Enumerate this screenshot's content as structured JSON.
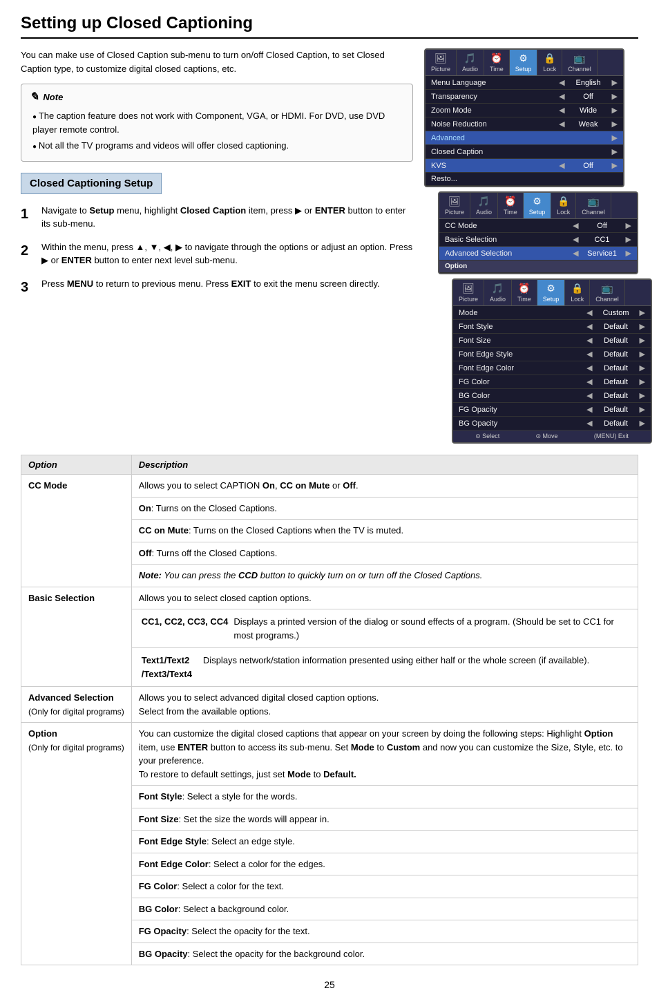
{
  "page": {
    "title": "Setting up Closed Captioning",
    "page_number": "25"
  },
  "intro": {
    "text": "You can make use of Closed Caption sub-menu to turn on/off Closed Caption, to set Closed Caption type, to customize digital closed captions, etc."
  },
  "note": {
    "header": "Note",
    "items": [
      "The caption feature does not work with Component, VGA, or HDMI. For DVD, use DVD player remote control.",
      "Not all the TV programs and videos will offer closed captioning."
    ]
  },
  "section": {
    "title": "Closed Captioning Setup"
  },
  "steps": [
    {
      "num": "1",
      "text": "Navigate to Setup menu, highlight Closed Caption item, press ▶ or ENTER button to enter its sub-menu."
    },
    {
      "num": "2",
      "text": "Within the menu, press ▲, ▼, ◀, ▶ to navigate through the options or adjust an option. Press ▶ or ENTER button to enter next level sub-menu."
    },
    {
      "num": "3",
      "text": "Press MENU to return to previous menu. Press EXIT to exit the menu screen directly."
    }
  ],
  "menus": [
    {
      "id": "menu1",
      "tabs": [
        {
          "label": "Picture",
          "icon": "🖼",
          "active": false
        },
        {
          "label": "Audio",
          "icon": "🎵",
          "active": false
        },
        {
          "label": "Time",
          "icon": "⏰",
          "active": false
        },
        {
          "label": "Setup",
          "icon": "⚙",
          "active": true
        },
        {
          "label": "Lock",
          "icon": "🔒",
          "active": false
        },
        {
          "label": "Channel",
          "icon": "📺",
          "active": false
        }
      ],
      "rows": [
        {
          "label": "Menu Language",
          "arrow_l": "◀",
          "value": "English",
          "arrow_r": "▶",
          "highlight": false,
          "section": false
        },
        {
          "label": "Transparency",
          "arrow_l": "◀",
          "value": "Off",
          "arrow_r": "▶",
          "highlight": false,
          "section": false
        },
        {
          "label": "Zoom Mode",
          "arrow_l": "◀",
          "value": "Wide",
          "arrow_r": "▶",
          "highlight": false,
          "section": false
        },
        {
          "label": "Noise Reduction",
          "arrow_l": "◀",
          "value": "Weak",
          "arrow_r": "▶",
          "highlight": false,
          "section": false
        },
        {
          "label": "Advanced",
          "arrow_l": "",
          "value": "",
          "arrow_r": "▶",
          "highlight": false,
          "section": true
        },
        {
          "label": "Closed Caption",
          "arrow_l": "",
          "value": "",
          "arrow_r": "▶",
          "highlight": false,
          "section": false
        },
        {
          "label": "KVS",
          "arrow_l": "◀",
          "value": "Off",
          "arrow_r": "▶",
          "highlight": true,
          "section": false
        },
        {
          "label": "Resto...",
          "arrow_l": "",
          "value": "",
          "arrow_r": "",
          "highlight": false,
          "section": false
        }
      ],
      "footer": []
    },
    {
      "id": "menu2",
      "tabs": [
        {
          "label": "Picture",
          "icon": "🖼",
          "active": false
        },
        {
          "label": "Audio",
          "icon": "🎵",
          "active": false
        },
        {
          "label": "Time",
          "icon": "⏰",
          "active": false
        },
        {
          "label": "Setup",
          "icon": "⚙",
          "active": true
        },
        {
          "label": "Lock",
          "icon": "🔒",
          "active": false
        },
        {
          "label": "Channel",
          "icon": "📺",
          "active": false
        }
      ],
      "rows": [
        {
          "label": "CC Mode",
          "arrow_l": "◀",
          "value": "Off",
          "arrow_r": "▶",
          "highlight": false,
          "section": false
        },
        {
          "label": "Basic Selection",
          "arrow_l": "◀",
          "value": "CC1",
          "arrow_r": "▶",
          "highlight": false,
          "section": false
        },
        {
          "label": "Advanced Selection",
          "arrow_l": "◀",
          "value": "Service1",
          "arrow_r": "▶",
          "highlight": true,
          "section": false
        },
        {
          "label": "Option",
          "arrow_l": "",
          "value": "",
          "arrow_r": "",
          "highlight": false,
          "section": true
        }
      ],
      "footer": []
    },
    {
      "id": "menu3",
      "tabs": [
        {
          "label": "Picture",
          "icon": "🖼",
          "active": false
        },
        {
          "label": "Audio",
          "icon": "🎵",
          "active": false
        },
        {
          "label": "Time",
          "icon": "⏰",
          "active": false
        },
        {
          "label": "Setup",
          "icon": "⚙",
          "active": true
        },
        {
          "label": "Lock",
          "icon": "🔒",
          "active": false
        },
        {
          "label": "Channel",
          "icon": "📺",
          "active": false
        }
      ],
      "rows": [
        {
          "label": "Mode",
          "arrow_l": "◀",
          "value": "Custom",
          "arrow_r": "▶",
          "highlight": false,
          "section": false
        },
        {
          "label": "Font Style",
          "arrow_l": "◀",
          "value": "Default",
          "arrow_r": "▶",
          "highlight": false,
          "section": false
        },
        {
          "label": "Font Size",
          "arrow_l": "◀",
          "value": "Default",
          "arrow_r": "▶",
          "highlight": false,
          "section": false
        },
        {
          "label": "Font Edge Style",
          "arrow_l": "◀",
          "value": "Default",
          "arrow_r": "▶",
          "highlight": false,
          "section": false
        },
        {
          "label": "Font Edge Color",
          "arrow_l": "◀",
          "value": "Default",
          "arrow_r": "▶",
          "highlight": false,
          "section": false
        },
        {
          "label": "FG Color",
          "arrow_l": "◀",
          "value": "Default",
          "arrow_r": "▶",
          "highlight": false,
          "section": false
        },
        {
          "label": "BG Color",
          "arrow_l": "◀",
          "value": "Default",
          "arrow_r": "▶",
          "highlight": false,
          "section": false
        },
        {
          "label": "FG Opacity",
          "arrow_l": "◀",
          "value": "Default",
          "arrow_r": "▶",
          "highlight": false,
          "section": false
        },
        {
          "label": "BG Opacity",
          "arrow_l": "◀",
          "value": "Default",
          "arrow_r": "▶",
          "highlight": false,
          "section": false
        }
      ],
      "footer": [
        {
          "icon": "⊙",
          "label": "Select"
        },
        {
          "icon": "⊙",
          "label": "Move"
        },
        {
          "icon": "MENU",
          "label": "Exit"
        }
      ]
    }
  ],
  "table": {
    "headers": [
      "Option",
      "Description"
    ],
    "rows": [
      {
        "option": "CC Mode",
        "option_sub": "",
        "description": "Allows you to select CAPTION On, CC on Mute or Off.",
        "sub_rows": [
          {
            "label": "On:",
            "text": "Turns on the Closed Captions."
          },
          {
            "label": "CC on Mute:",
            "text": "Turns on the Closed Captions when the TV is muted."
          },
          {
            "label": "Off:",
            "text": "Turns off the Closed Captions."
          }
        ],
        "note": "Note: You can press the CCD button to quickly turn on or turn off the Closed Captions."
      },
      {
        "option": "Basic Selection",
        "option_sub": "",
        "description": "Allows you to select closed caption options.",
        "sub_rows": [
          {
            "label": "CC1, CC2, CC3, CC4",
            "text": "Displays a printed version of the dialog or sound effects of a program. (Should be set to CC1 for most programs.)"
          },
          {
            "label": "Text1/Text2/Text3/Text4",
            "text": "Displays network/station information presented using either half or the whole screen (if available)."
          }
        ],
        "note": ""
      },
      {
        "option": "Advanced Selection",
        "option_sub": "(Only for digital programs)",
        "description": "Allows you to select advanced digital closed caption options.\nSelect from the available options.",
        "sub_rows": [],
        "note": ""
      },
      {
        "option": "Option",
        "option_sub": "(Only for digital programs)",
        "description": "You can customize the digital closed captions that appear on your screen by doing the following steps: Highlight Option item, use ENTER button to access its sub-menu. Set Mode to Custom and now you can customize the Size, Style, etc. to your preference.\nTo restore to default settings, just set Mode to Default.",
        "sub_rows": [
          {
            "label": "Font Style:",
            "text": "Select a style for the words."
          },
          {
            "label": "Font Size:",
            "text": "Set the size the words will appear in."
          },
          {
            "label": "Font Edge Style:",
            "text": "Select an edge style."
          },
          {
            "label": "Font Edge Color:",
            "text": "Select a color for the edges."
          },
          {
            "label": "FG Color:",
            "text": "Select a color for the text."
          },
          {
            "label": "BG Color:",
            "text": "Select a background color."
          },
          {
            "label": "FG Opacity:",
            "text": "Select the opacity for the text."
          },
          {
            "label": "BG Opacity:",
            "text": "Select the opacity for the background color."
          }
        ],
        "note": ""
      }
    ]
  }
}
